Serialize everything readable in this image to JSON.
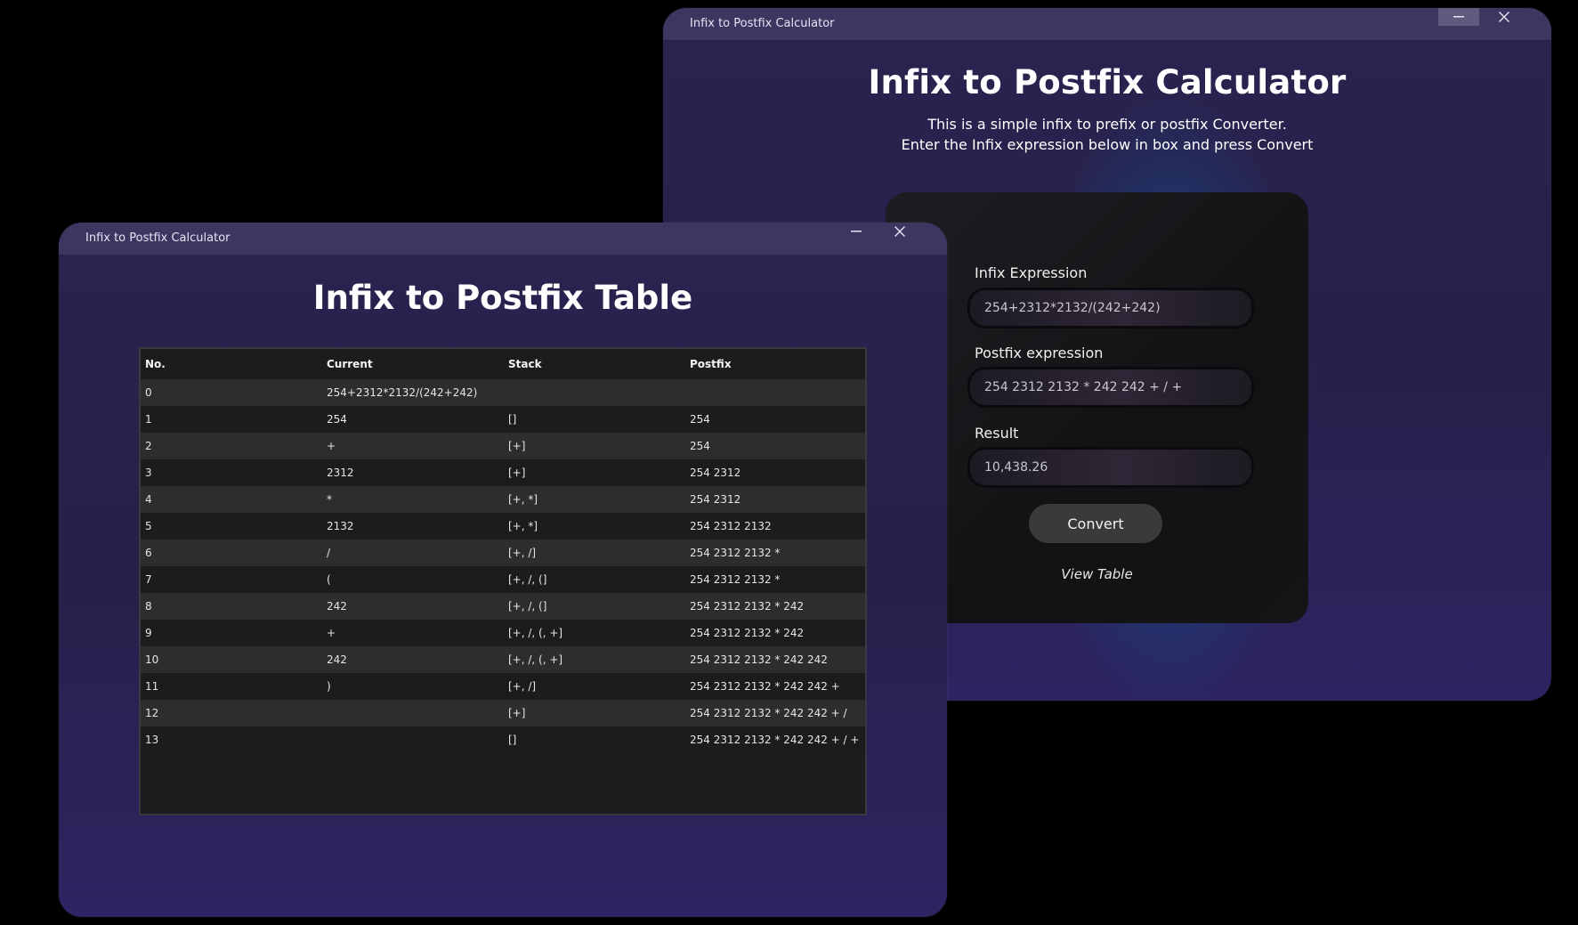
{
  "calc_window": {
    "title": "Infix to Postfix Calculator",
    "heading": "Infix to Postfix Calculator",
    "description_line1": "This is a simple infix to prefix or postfix Converter.",
    "description_line2": "Enter the Infix expression below in box and press Convert",
    "infix_label": "Infix Expression",
    "infix_value": "254+2312*2132/(242+242)",
    "postfix_label": "Postfix expression",
    "postfix_value": "254 2312 2132 * 242 242 + / +",
    "result_label": "Result",
    "result_value": "10,438.26",
    "convert_label": "Convert",
    "view_table_label": "View Table"
  },
  "table_window": {
    "title": "Infix to Postfix Calculator",
    "heading": "Infix to Postfix Table",
    "columns": [
      "No.",
      "Current",
      "Stack",
      "Postfix"
    ],
    "rows": [
      [
        "0",
        "254+2312*2132/(242+242)",
        "",
        ""
      ],
      [
        "1",
        "254",
        "[]",
        "254"
      ],
      [
        "2",
        "+",
        "[+]",
        "254"
      ],
      [
        "3",
        "2312",
        "[+]",
        "254 2312"
      ],
      [
        "4",
        "*",
        "[+, *]",
        "254 2312"
      ],
      [
        "5",
        "2132",
        "[+, *]",
        "254 2312 2132"
      ],
      [
        "6",
        "/",
        "[+, /]",
        "254 2312 2132 *"
      ],
      [
        "7",
        "(",
        "[+, /, (]",
        "254 2312 2132 *"
      ],
      [
        "8",
        "242",
        "[+, /, (]",
        "254 2312 2132 * 242"
      ],
      [
        "9",
        "+",
        "[+, /, (, +]",
        "254 2312 2132 * 242"
      ],
      [
        "10",
        "242",
        "[+, /, (, +]",
        "254 2312 2132 * 242 242"
      ],
      [
        "11",
        ")",
        "[+, /]",
        "254 2312 2132 * 242 242 +"
      ],
      [
        "12",
        "",
        "[+]",
        "254 2312 2132 * 242 242 + /"
      ],
      [
        "13",
        "",
        "[]",
        "254 2312 2132 * 242 242 + / +"
      ]
    ]
  },
  "colors": {
    "window_bg": "#2a2350",
    "titlebar_bg": "#3b3761",
    "card_bg": "#121214",
    "glow": "#0e6caa",
    "row_even": "#2d2d2f",
    "row_odd": "#1c1c1e"
  }
}
